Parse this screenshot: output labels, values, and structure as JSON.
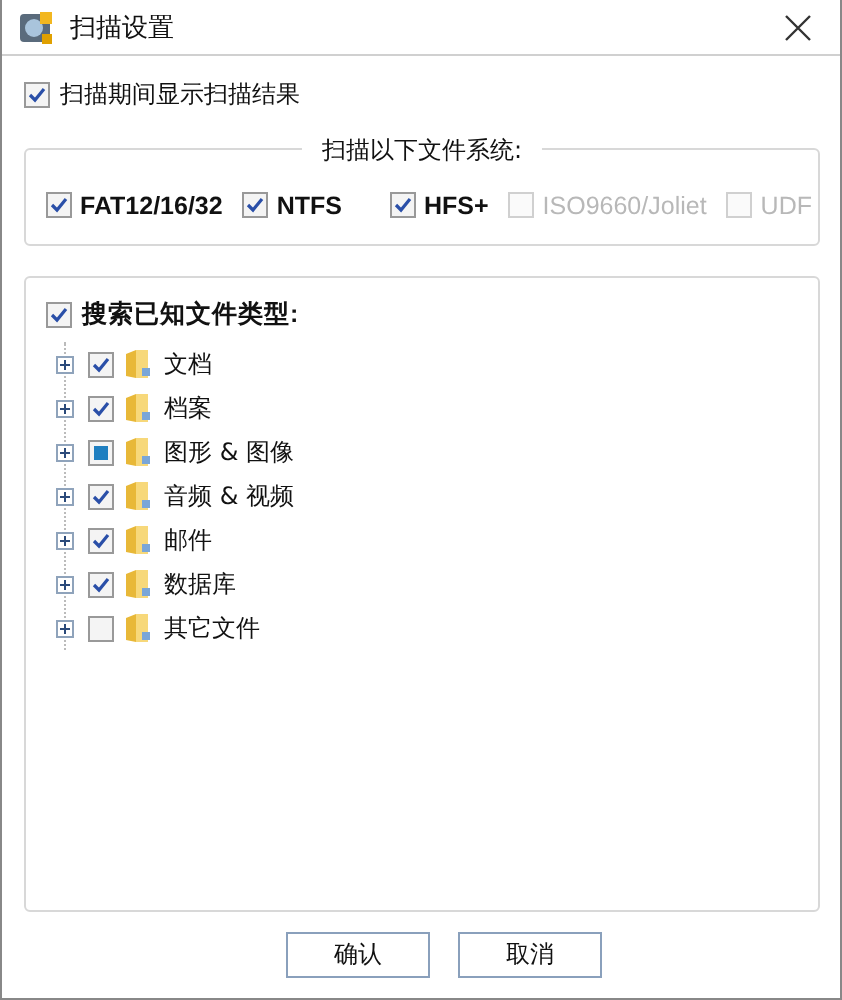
{
  "window": {
    "title": "扫描设置"
  },
  "show_results": {
    "label": "扫描期间显示扫描结果",
    "checked": true
  },
  "file_systems": {
    "legend": "扫描以下文件系统:",
    "items": [
      {
        "label": "FAT12/16/32",
        "checked": true,
        "disabled": false
      },
      {
        "label": "NTFS",
        "checked": true,
        "disabled": false
      },
      {
        "label": "HFS+",
        "checked": true,
        "disabled": false
      },
      {
        "label": "ISO9660/Joliet",
        "checked": false,
        "disabled": true
      },
      {
        "label": "UDF",
        "checked": false,
        "disabled": true
      }
    ]
  },
  "file_types": {
    "label": "搜索已知文件类型:",
    "checked": true,
    "items": [
      {
        "label": "文档",
        "checked": true,
        "partial": false,
        "expanded": false
      },
      {
        "label": "档案",
        "checked": true,
        "partial": false,
        "expanded": false
      },
      {
        "label": "图形 & 图像",
        "checked": false,
        "partial": true,
        "expanded": false
      },
      {
        "label": "音频 & 视频",
        "checked": true,
        "partial": false,
        "expanded": false
      },
      {
        "label": "邮件",
        "checked": true,
        "partial": false,
        "expanded": false
      },
      {
        "label": "数据库",
        "checked": true,
        "partial": false,
        "expanded": false
      },
      {
        "label": "其它文件",
        "checked": false,
        "partial": false,
        "expanded": false
      }
    ]
  },
  "buttons": [
    "确认",
    "取消"
  ]
}
